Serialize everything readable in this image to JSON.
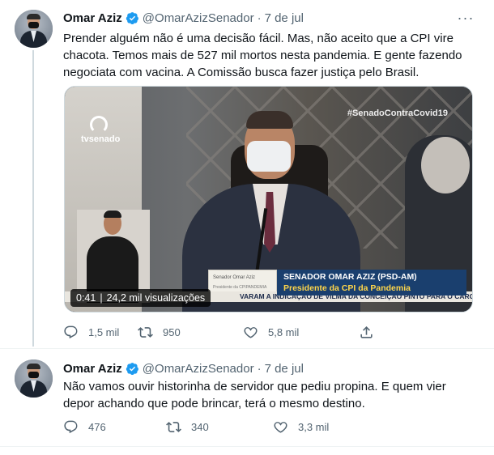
{
  "tweets": [
    {
      "author": {
        "name": "Omar Aziz",
        "handle": "@OmarAzizSenador"
      },
      "date": "7 de jul",
      "separator": "·",
      "text_lines": [
        "Prender alguém não é uma decisão fácil. Mas, não aceito que a CPI vire",
        "chacota. Temos mais de 527 mil mortos nesta pandemia. E gente fazendo",
        "negociata com vacina. A Comissão busca fazer justiça pelo Brasil."
      ],
      "video": {
        "duration": "0:41",
        "views": "24,2 mil visualizações",
        "channel_logo_text": "tvsenado",
        "hashtag": "#SenadoContraCovid19",
        "lower_third_name": "SENADOR OMAR AZIZ (PSD-AM)",
        "lower_third_role": "Presidente da CPI da Pandemia",
        "ticker": "VARAM A INDICAÇÃO DE VILMA DA CONCEIÇÃO PINTO PARA O CARGO DE DIR",
        "nameplate_title": "Senador Omar Aziz",
        "nameplate_subtitle": "Presidente da CPIPANDEMIA"
      },
      "actions": {
        "replies": "1,5 mil",
        "retweets": "950",
        "likes": "5,8 mil"
      }
    },
    {
      "author": {
        "name": "Omar Aziz",
        "handle": "@OmarAzizSenador"
      },
      "date": "7 de jul",
      "separator": "·",
      "text_lines": [
        "Não vamos ouvir historinha de servidor que pediu propina. E quem vier",
        "depor achando que pode brincar, terá o mesmo destino."
      ],
      "actions": {
        "replies": "476",
        "retweets": "340",
        "likes": "3,3 mil"
      }
    }
  ],
  "more_icon": "···",
  "icons": {
    "verified": "verified-badge-icon",
    "reply": "reply-icon",
    "retweet": "retweet-icon",
    "like": "heart-icon",
    "share": "share-icon",
    "more": "more-icon"
  },
  "colors": {
    "text": "#0f1419",
    "secondary": "#536471",
    "verified": "#1d9bf0",
    "border": "#eff3f4",
    "thread_line": "#cfd9de"
  }
}
